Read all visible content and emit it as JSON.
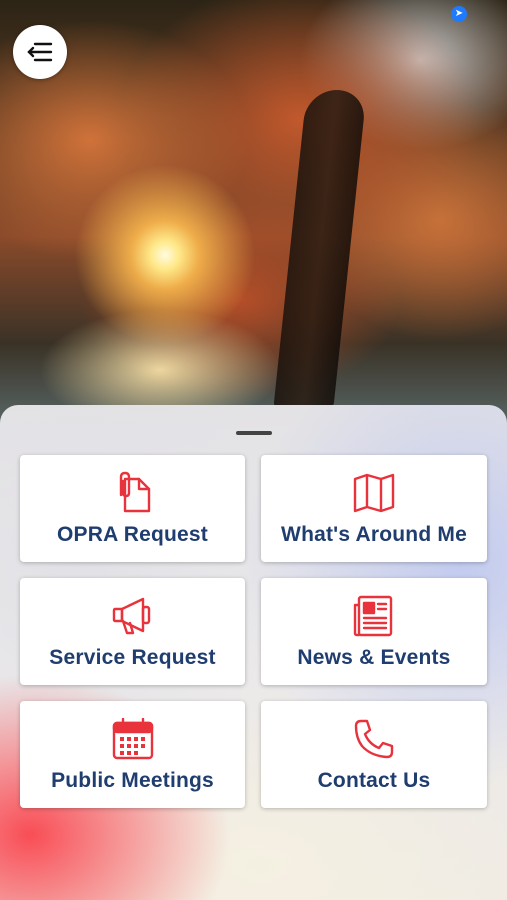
{
  "header": {
    "menu_icon": "menu-back-icon",
    "location_icon": "location-arrow-icon"
  },
  "tiles": [
    {
      "label": "OPRA Request",
      "icon": "document-clip-icon"
    },
    {
      "label": "What's Around Me",
      "icon": "map-icon"
    },
    {
      "label": "Service Request",
      "icon": "megaphone-icon"
    },
    {
      "label": "News & Events",
      "icon": "newspaper-icon"
    },
    {
      "label": "Public Meetings",
      "icon": "calendar-icon"
    },
    {
      "label": "Contact Us",
      "icon": "phone-icon"
    }
  ],
  "colors": {
    "icon_red": "#e8323c",
    "label_navy": "#1f3d6e",
    "tile_bg": "#ffffff"
  }
}
